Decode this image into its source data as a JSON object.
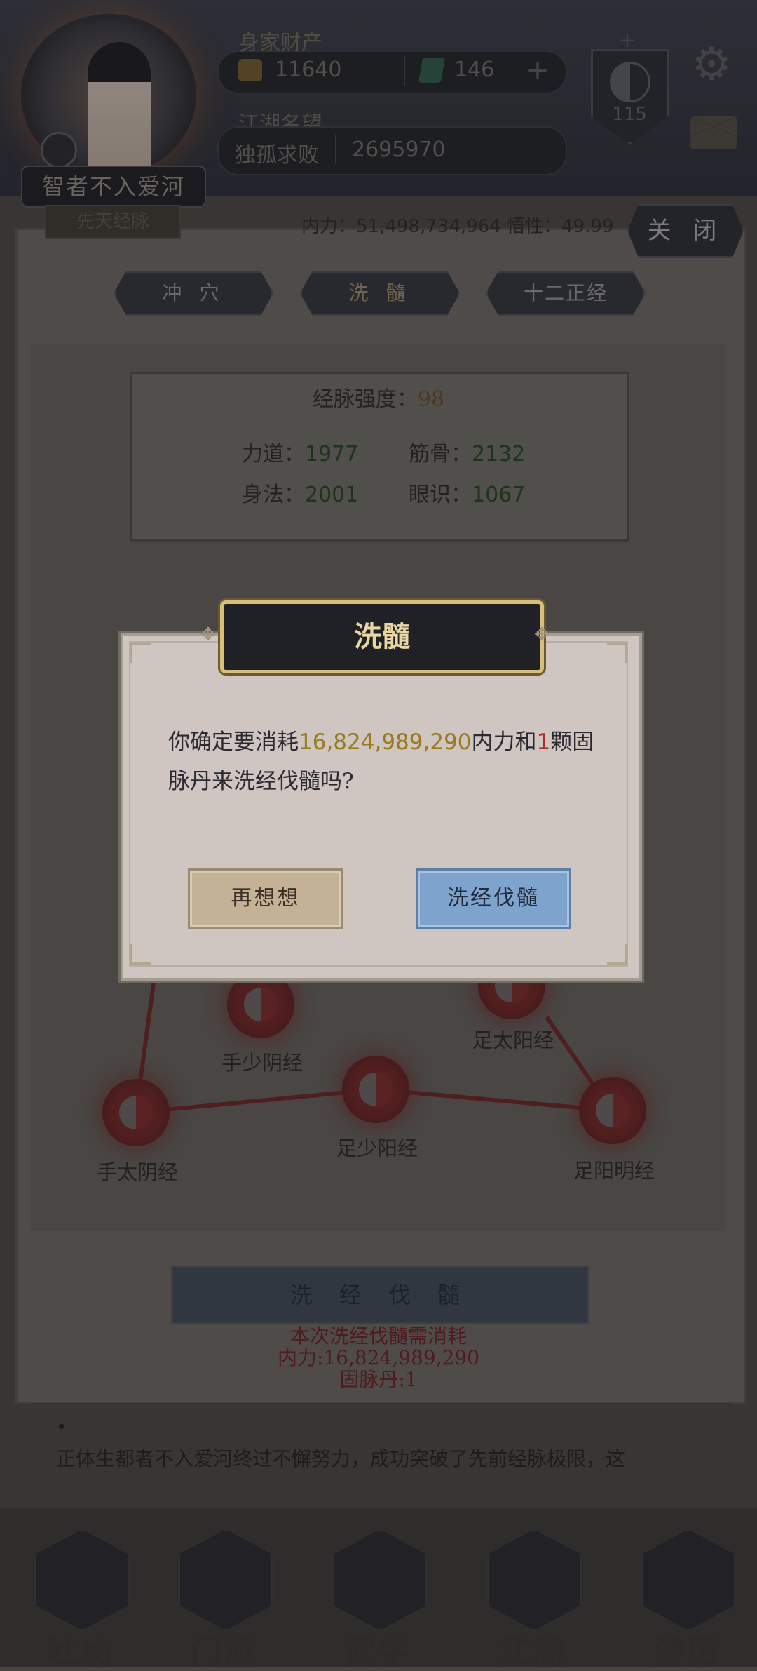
{
  "header": {
    "player_name": "智者不入爱河",
    "assets_label": "身家财产",
    "gold": "11640",
    "jade": "146",
    "add_symbol": "+",
    "fame_label": "江湖名望",
    "fame_title": "独孤求败",
    "fame_value": "2695970",
    "level": "115",
    "level_top_mark": "+"
  },
  "panel": {
    "sub_tab_partial": "先天经脉",
    "stats_line": "内力：51,498,734,964   悟性：49.99",
    "close_label": "关 闭",
    "tabs": [
      "冲 穴",
      "洗 髓",
      "十二正经"
    ],
    "meridian_strength_label": "经脉强度：",
    "meridian_strength_value": "98",
    "stats": {
      "lidao_label": "力道：",
      "lidao_value": "1977",
      "jingu_label": "筋骨：",
      "jingu_value": "2132",
      "shenfa_label": "身法：",
      "shenfa_value": "2001",
      "yanshi_label": "眼识：",
      "yanshi_value": "1067"
    },
    "nodes": [
      "手少阴经",
      "足太阳经",
      "手太阴经",
      "足少阳经",
      "足阳明经"
    ],
    "wash_button_label": "洗 经 伐 髓",
    "cost_title": "本次洗经伐髓需消耗",
    "cost_neili": "内力:16,824,989,290",
    "cost_pill": "固脉丹:1",
    "story_bullet": "•",
    "story_text": "正体生都者不入爱河终过不懈努力，成功突破了先前经脉极限，这"
  },
  "dialog": {
    "title": "洗髓",
    "wing_left": "✥",
    "wing_right": "✥",
    "msg_prefix": "你确定要消耗",
    "msg_amount": "16,824,989,290",
    "msg_middle": "内力和",
    "msg_count": "1",
    "msg_suffix": "颗固脉丹来洗经伐髓吗?",
    "cancel_label": "再想想",
    "confirm_label": "洗经伐髓"
  },
  "bottom_nav": [
    "吐纳",
    "门派",
    "武学",
    "江湖",
    "游历"
  ],
  "icons": {
    "settings": "gear-icon",
    "mail": "mail-icon",
    "gold": "gold-ingot-icon",
    "jade": "jade-icon",
    "level": "yinyang-icon"
  },
  "colors": {
    "dialog_bg": "#cfc6c2",
    "title_bg": "#202027",
    "title_border": "#d7bf7a",
    "amount": "#9c7a22",
    "count": "#b12a2a",
    "confirm_button": "#7ea3cc",
    "cancel_button": "#c4b297"
  }
}
